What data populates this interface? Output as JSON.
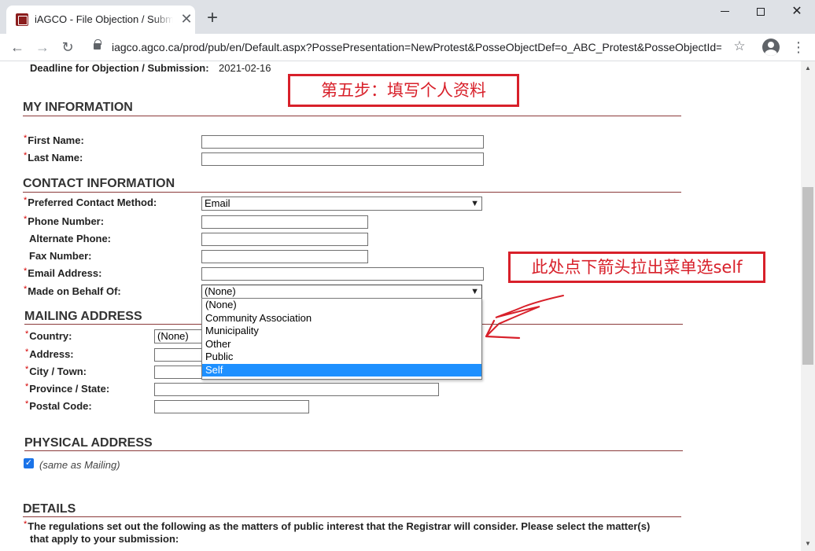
{
  "browser": {
    "tab_title": "iAGCO - File Objection / Submission",
    "close_glyph": "✕",
    "new_tab_glyph": "+",
    "url": "iagco.agco.ca/prod/pub/en/Default.aspx?PossePresentation=NewProtest&PosseObjectDef=o_ABC_Protest&PosseObjectId=...",
    "back_glyph": "←",
    "forward_glyph": "→",
    "reload_glyph": "↻",
    "star_glyph": "☆",
    "menu_glyph": "⋮",
    "window_close_glyph": "✕"
  },
  "page": {
    "deadline_label": "Deadline for Objection / Submission:",
    "deadline_value": "2021-02-16",
    "required_marker": "*",
    "my_information": {
      "title": "MY INFORMATION",
      "first_name_label": "First Name:",
      "last_name_label": "Last Name:"
    },
    "contact_information": {
      "title": "CONTACT INFORMATION",
      "preferred_method_label": "Preferred Contact Method:",
      "preferred_method_value": "Email",
      "phone_label": "Phone Number:",
      "alternate_phone_label": "Alternate Phone:",
      "fax_label": "Fax Number:",
      "email_label": "Email Address:",
      "behalf_label": "Made on Behalf Of:",
      "behalf_value": "(None)",
      "behalf_options": [
        "(None)",
        "Community Association",
        "Municipality",
        "Other",
        "Public",
        "Self"
      ],
      "behalf_highlighted": "Self"
    },
    "mailing_address": {
      "title": "MAILING ADDRESS",
      "country_label": "Country:",
      "country_value": "(None)",
      "address_label": "Address:",
      "city_label": "City / Town:",
      "province_label": "Province / State:",
      "postal_label": "Postal Code:"
    },
    "physical_address": {
      "title": "PHYSICAL ADDRESS",
      "same_as_mailing": "(same as Mailing)",
      "check_glyph": "✓"
    },
    "details": {
      "title": "DETAILS",
      "text_line1": "The regulations set out the following as the matters of public interest that the Registrar will consider. Please select the matter(s)",
      "text_line2": "that apply to your submission:"
    }
  },
  "annotations": {
    "step_label": "第五步：填写个人资料",
    "hint_label": "此处点下箭头拉出菜单选self",
    "accent_color": "#d8202a"
  },
  "colors": {
    "dropdown_highlight": "#1e90ff",
    "section_rule": "#8b3a3a",
    "checkbox": "#1a73e8"
  }
}
